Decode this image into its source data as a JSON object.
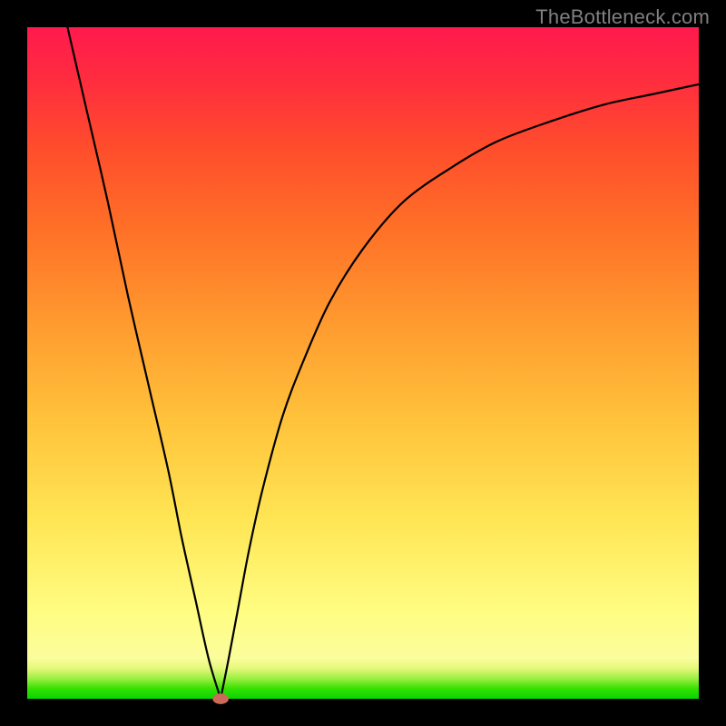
{
  "watermark": "TheBottleneck.com",
  "chart_data": {
    "type": "line",
    "title": "",
    "xlabel": "",
    "ylabel": "",
    "xlim": [
      0,
      100
    ],
    "ylim": [
      0,
      100
    ],
    "grid": false,
    "legend": false,
    "background_gradient": [
      "#06d600",
      "#fffd82",
      "#ff9a2f",
      "#ff1a4e"
    ],
    "series": [
      {
        "name": "left-branch",
        "x": [
          6,
          9,
          12,
          15,
          18,
          21,
          23,
          25,
          27,
          28.8
        ],
        "y": [
          100,
          87,
          74,
          60,
          47,
          34,
          24,
          15,
          6,
          0
        ]
      },
      {
        "name": "right-branch",
        "x": [
          28.8,
          30,
          31.5,
          33,
          35,
          38,
          41,
          45,
          50,
          56,
          63,
          70,
          78,
          86,
          93,
          100
        ],
        "y": [
          0,
          6,
          14,
          22,
          31,
          42,
          50,
          59,
          67,
          74,
          79,
          83,
          86,
          88.5,
          90,
          91.5
        ]
      }
    ],
    "marker": {
      "x": 28.8,
      "y": 0,
      "rx": 1.2,
      "ry": 0.8,
      "color": "#cc6a5a"
    }
  }
}
